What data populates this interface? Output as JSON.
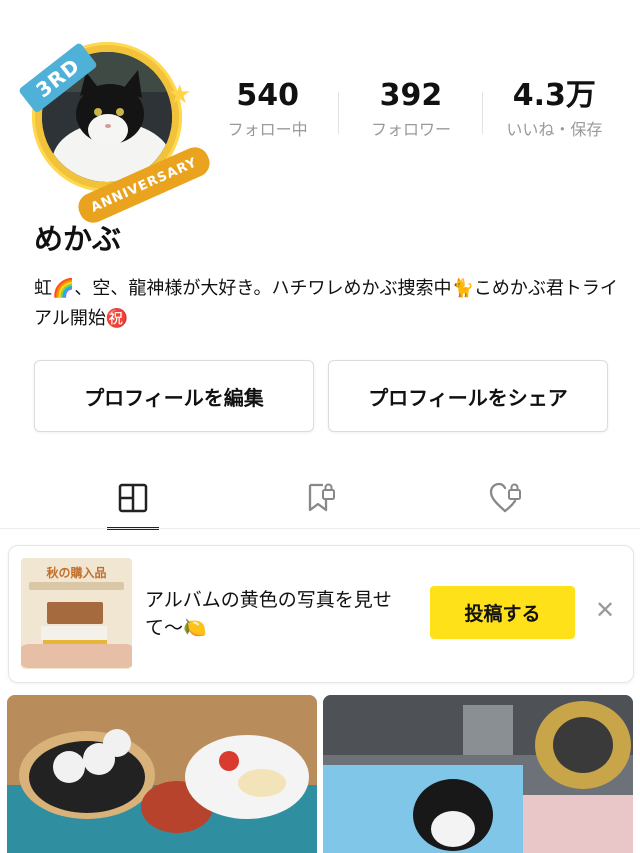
{
  "profile": {
    "badge_text": "3RD",
    "anniversary_text": "ANNIVERSARY",
    "username": "めかぶ",
    "bio": "虹🌈、空、龍神様が大好き。ハチワレめかぶ捜索中🐈こめかぶ君トライアル開始㊗️"
  },
  "stats": [
    {
      "value": "540",
      "label": "フォロー中"
    },
    {
      "value": "392",
      "label": "フォロワー"
    },
    {
      "value": "4.3万",
      "label": "いいね・保存"
    }
  ],
  "buttons": {
    "edit": "プロフィールを編集",
    "share": "プロフィールをシェア"
  },
  "tabs": [
    {
      "icon": "grid-icon",
      "active": true
    },
    {
      "icon": "bookmark-lock-icon",
      "active": false
    },
    {
      "icon": "heart-lock-icon",
      "active": false
    }
  ],
  "promo": {
    "thumb_title": "秋の購入品",
    "text": "アルバムの黄色の写真を見せて〜🍋",
    "post_label": "投稿する",
    "close_icon": "close-icon"
  },
  "colors": {
    "accent_yellow": "#ffe11a",
    "badge_blue": "#4fb1d8",
    "ring_gold": "#f2c23a"
  }
}
